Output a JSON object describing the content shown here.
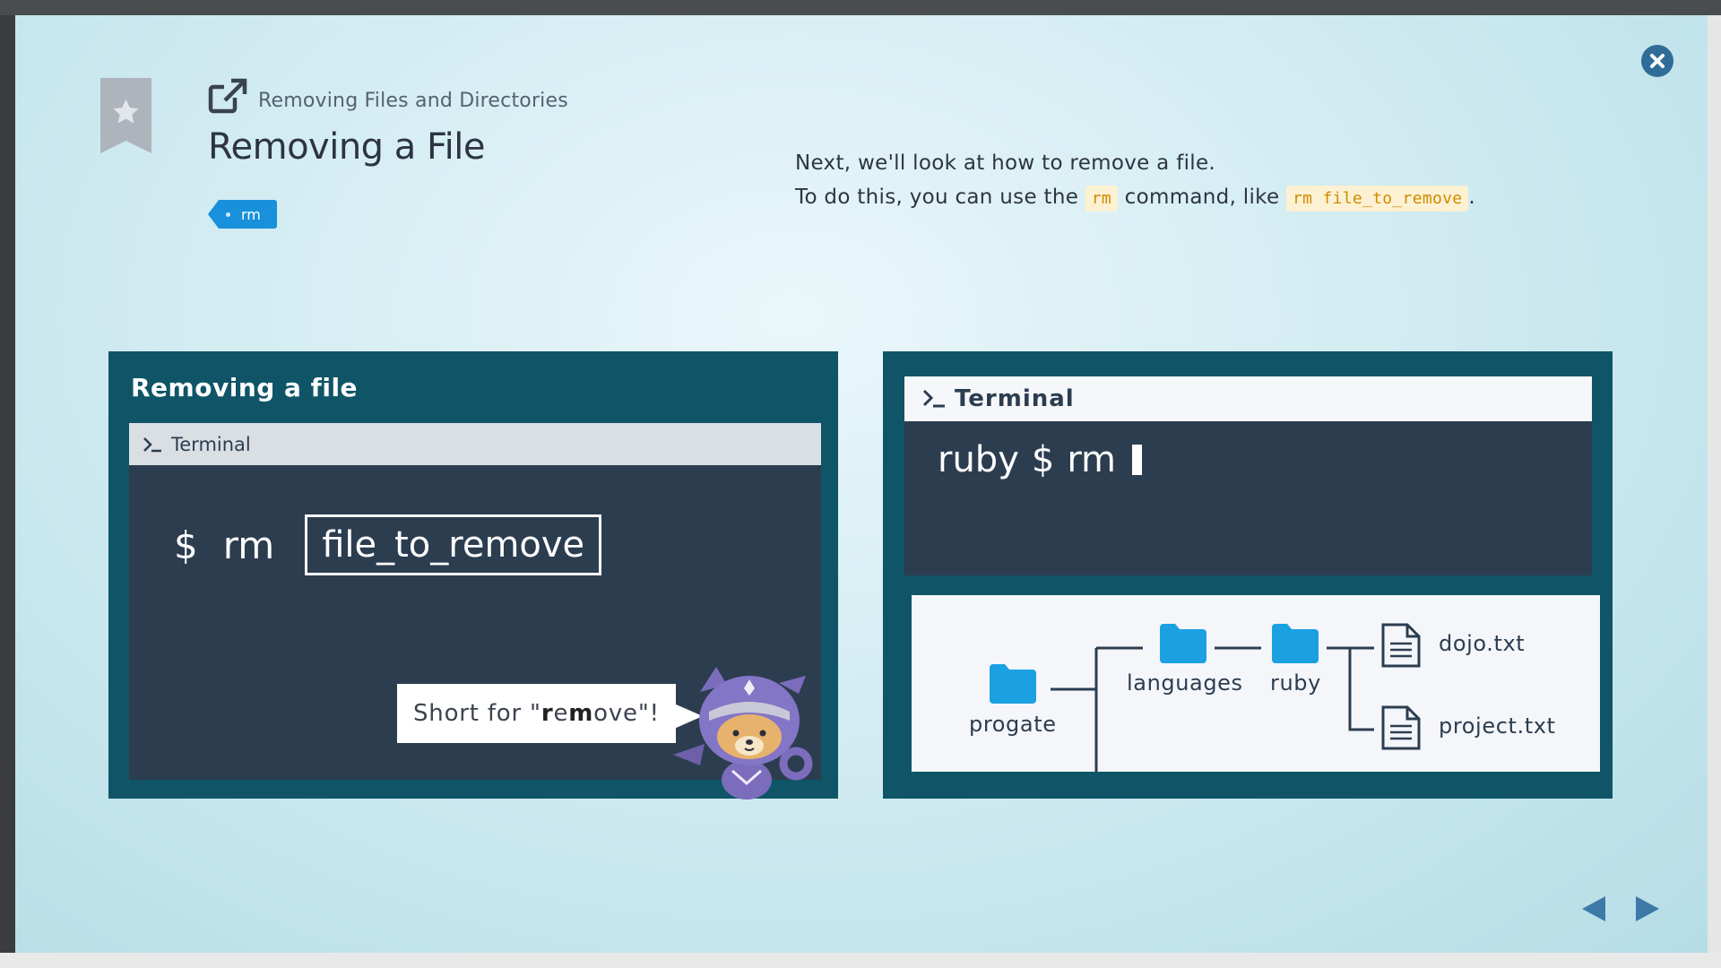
{
  "header": {
    "chapter_title": "Removing Files and Directories",
    "lesson_title": "Removing a File",
    "tag_label": "rm"
  },
  "description": {
    "line1": "Next, we'll look at how to remove a file.",
    "line2_prefix": "To do this, you can use the ",
    "line2_code1": "rm",
    "line2_middle": " command, like ",
    "line2_code2": "rm file_to_remove",
    "line2_suffix": "."
  },
  "left_panel": {
    "heading": "Removing a file",
    "terminal_title": "Terminal",
    "prompt": "$",
    "command": "rm",
    "argument": "file_to_remove",
    "speech_prefix": "Short for \"",
    "speech_r": "r",
    "speech_e": "e",
    "speech_m": "m",
    "speech_ove": "ove",
    "speech_suffix": "\"!"
  },
  "right_panel": {
    "terminal_title": "Terminal",
    "prompt_dir": "ruby",
    "prompt": "$",
    "command": "rm",
    "tree": {
      "root": "progate",
      "child": "languages",
      "grandchild": "ruby",
      "files": [
        "dojo.txt",
        "project.txt"
      ]
    }
  },
  "icons": {
    "bookmark": "bookmark-star-icon",
    "external": "external-link-icon",
    "close": "close-icon",
    "prev": "prev-arrow-icon",
    "next": "next-arrow-icon"
  },
  "colors": {
    "accent_blue": "#1990dc",
    "panel_teal": "#0f5567",
    "terminal_dark": "#2c3d50",
    "code_text": "#d18a00",
    "folder_blue": "#1ba1e2",
    "nav_blue": "#3e79a8"
  }
}
